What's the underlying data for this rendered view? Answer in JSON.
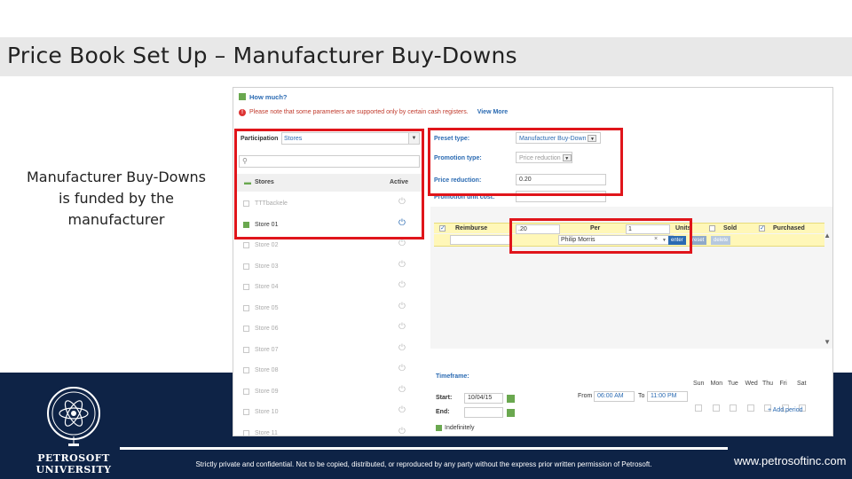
{
  "slide": {
    "title": "Price Book Set Up – Manufacturer Buy-Downs",
    "caption": "Manufacturer Buy-Downs is funded by the manufacturer"
  },
  "footer": {
    "logo_line1": "PETROSOFT",
    "logo_line2": "UNIVERSITY",
    "legal": "Strictly private and confidential. Not to be copied, distributed, or reproduced by any party without the express prior written permission of Petrosoft.",
    "url": "www.petrosoftinc.com"
  },
  "app": {
    "how_much": "How much?",
    "notice": "Please note that some parameters are supported only by certain cash registers.",
    "view_more": "View More",
    "participation_label": "Participation",
    "participation_value": "Stores",
    "search_icon": "magnifier-icon",
    "list_col_stores": "Stores",
    "list_col_active": "Active",
    "stores": [
      {
        "name": "TTTbackele",
        "checked": false
      },
      {
        "name": "Store 01",
        "checked": true
      },
      {
        "name": "Store 02",
        "checked": false
      },
      {
        "name": "Store 03",
        "checked": false
      },
      {
        "name": "Store 04",
        "checked": false
      },
      {
        "name": "Store 05",
        "checked": false
      },
      {
        "name": "Store 06",
        "checked": false
      },
      {
        "name": "Store 07",
        "checked": false
      },
      {
        "name": "Store 08",
        "checked": false
      },
      {
        "name": "Store 09",
        "checked": false
      },
      {
        "name": "Store 10",
        "checked": false
      },
      {
        "name": "Store 11",
        "checked": false
      }
    ],
    "preset_type_label": "Preset type:",
    "preset_type_value": "Manufacturer Buy-Down",
    "promotion_type_label": "Promotion type:",
    "promotion_type_value": "Price reduction",
    "price_reduction_label": "Price reduction:",
    "price_reduction_value": "0.20",
    "promotion_unit_cost_label": "Promotion unit cost:",
    "reimburse_label": "Reimburse",
    "reimburse_value": ".20",
    "per_label": "Per",
    "per_value": "1",
    "units_label": "Units",
    "sold_label": "Sold",
    "purchased_label": "Purchased",
    "vendor_value": "Philip Morris",
    "clear_x": "×",
    "btn_enter": "enter",
    "btn_reset": "reset",
    "btn_delete": "delete",
    "timeframe_label": "Timeframe:",
    "start_label": "Start:",
    "start_value": "10/04/15",
    "end_label": "End:",
    "from_label": "From",
    "from_value": "06:00 AM",
    "to_label": "To",
    "to_value": "11:00 PM",
    "days": [
      "Sun",
      "Mon",
      "Tue",
      "Wed",
      "Thu",
      "Fri",
      "Sat"
    ],
    "add_period": "+ Add period",
    "indefinitely": "Indefinitely"
  }
}
